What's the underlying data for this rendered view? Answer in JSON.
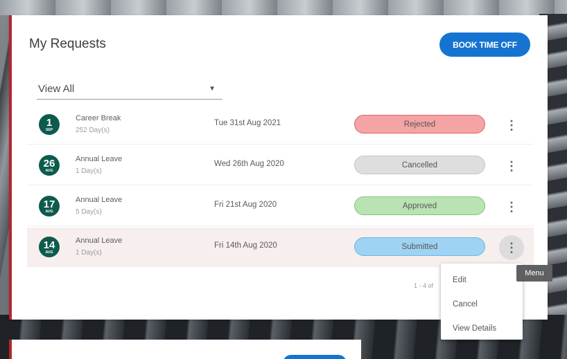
{
  "card": {
    "title": "My Requests",
    "book_button": "BOOK TIME OFF",
    "filter_value": "View All"
  },
  "requests": [
    {
      "day": "1",
      "month": "SEP",
      "type": "Career Break",
      "duration": "252 Day(s)",
      "date": "Tue 31st Aug 2021",
      "status": "Rejected",
      "status_bg": "#f4a4a4",
      "status_border": "#e06464"
    },
    {
      "day": "26",
      "month": "AUG",
      "type": "Annual Leave",
      "duration": "1 Day(s)",
      "date": "Wed 26th Aug 2020",
      "status": "Cancelled",
      "status_bg": "#dedede",
      "status_border": "#c4c4c4"
    },
    {
      "day": "17",
      "month": "AUG",
      "type": "Annual Leave",
      "duration": "5 Day(s)",
      "date": "Fri 21st Aug 2020",
      "status": "Approved",
      "status_bg": "#b9e3b2",
      "status_border": "#7fc675"
    },
    {
      "day": "14",
      "month": "AUG",
      "type": "Annual Leave",
      "duration": "1 Day(s)",
      "date": "Fri 14th Aug 2020",
      "status": "Submitted",
      "status_bg": "#9fd3f3",
      "status_border": "#6db7e6"
    }
  ],
  "pager": {
    "text": "1 - 4 of"
  },
  "menu": {
    "tooltip": "Menu",
    "items": [
      "Edit",
      "Cancel",
      "View Details"
    ]
  },
  "colors": {
    "accent": "#1674d1",
    "badge": "#0d5b4c",
    "card_border": "#b3262d"
  },
  "icons": {
    "kebab": "more-vert-icon",
    "caret": "dropdown-caret-icon"
  }
}
